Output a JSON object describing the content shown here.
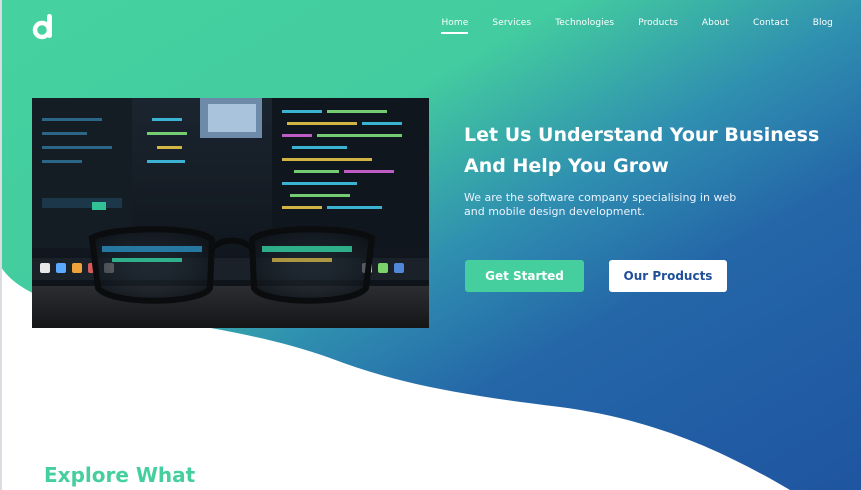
{
  "brand": {
    "logo_letter": "d"
  },
  "nav": {
    "items": [
      "Home",
      "Services",
      "Technologies",
      "Products",
      "About",
      "Contact",
      "Blog"
    ],
    "active": "Home"
  },
  "hero": {
    "title_line1": "Let Us Understand Your Business",
    "title_line2": "And Help You Grow",
    "subtitle": "We are the software company specialising in web and mobile design development.",
    "primary_button": "Get Started",
    "secondary_button": "Our Products"
  },
  "section": {
    "title": "Explore What"
  },
  "colors": {
    "accent_green": "#45cf9f",
    "hero_blue": "#1f55a0",
    "text_white": "#ffffff",
    "button_text_blue": "#1f4f99"
  },
  "icons": {
    "logo": "d-letter-logo-icon",
    "hero_image": "glasses-on-code-screen-photo"
  }
}
